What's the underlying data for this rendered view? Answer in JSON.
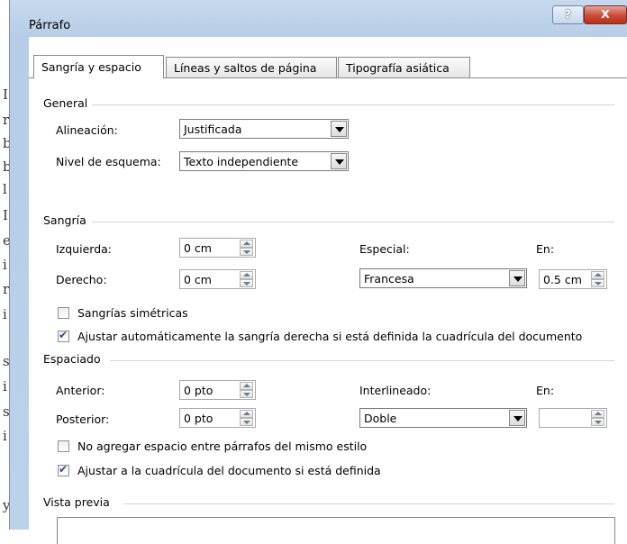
{
  "window": {
    "title": "Párrafo",
    "help_glyph": "?",
    "close_glyph": "X"
  },
  "tabs": [
    "Sangría y espacio",
    "Líneas y saltos de página",
    "Tipografía asiática"
  ],
  "general": {
    "section": "General",
    "alineacion_label": "Alineación:",
    "alineacion_value": "Justificada",
    "nivel_label": "Nivel de esquema:",
    "nivel_value": "Texto independiente"
  },
  "sangria": {
    "section": "Sangría",
    "izquierda_label": "Izquierda:",
    "izquierda_value": "0 cm",
    "derecho_label": "Derecho:",
    "derecho_value": "0 cm",
    "especial_label": "Especial:",
    "especial_value": "Francesa",
    "en_label": "En:",
    "en_value": "0.5 cm",
    "simetricas_label": "Sangrías simétricas",
    "simetricas_checked": false,
    "ajustar_label": "Ajustar automáticamente la sangría derecha si está definida la cuadrícula del documento",
    "ajustar_checked": true
  },
  "espaciado": {
    "section": "Espaciado",
    "anterior_label": "Anterior:",
    "anterior_value": "0 pto",
    "posterior_label": "Posterior:",
    "posterior_value": "0 pto",
    "interlineado_label": "Interlineado:",
    "interlineado_value": "Doble",
    "en_label": "En:",
    "en_value": "",
    "no_agregar_label": "No agregar espacio entre párrafos del mismo estilo",
    "no_agregar_checked": false,
    "ajustar_label": "Ajustar a la cuadrícula del documento si está definida",
    "ajustar_checked": true
  },
  "vista_previa": {
    "section": "Vista previa"
  },
  "background_letters": [
    "I",
    "r",
    "b",
    "b",
    "l",
    "I",
    "e",
    "i",
    "r",
    "i",
    "s",
    "i",
    "s",
    "i",
    "y"
  ],
  "colors": {
    "title_gradient": "#c7d9ee",
    "close_button": "#c94b35",
    "checkmark": "#2b4f8a"
  }
}
